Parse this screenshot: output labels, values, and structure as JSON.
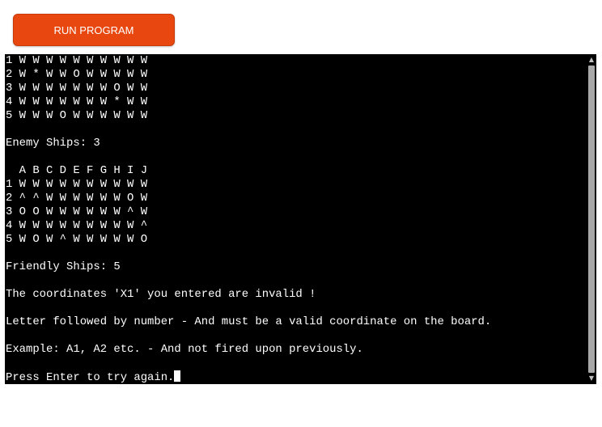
{
  "run_button": {
    "label": "RUN PROGRAM",
    "color": "#e8470f"
  },
  "terminal": {
    "lines": [
      "1 W W W W W W W W W W",
      "2 W * W W O W W W W W",
      "3 W W W W W W W O W W",
      "4 W W W W W W W * W W",
      "5 W W W O W W W W W W",
      "",
      "Enemy Ships: 3",
      "",
      "  A B C D E F G H I J",
      "1 W W W W W W W W W W",
      "2 ^ ^ W W W W W W O W",
      "3 O O W W W W W W ^ W",
      "4 W W W W W W W W W ^",
      "5 W O W ^ W W W W W O",
      "",
      "Friendly Ships: 5",
      "",
      "The coordinates 'X1' you entered are invalid !",
      "",
      "Letter followed by number - And must be a valid coordinate on the board.",
      "",
      "Example: A1, A2 etc. - And not fired upon previously.",
      "",
      "Press Enter to try again."
    ],
    "background": "#000000",
    "text_color": "#ffffff"
  },
  "scrollbar": {
    "up_icon": "scroll-up-arrow",
    "down_icon": "scroll-down-arrow"
  }
}
